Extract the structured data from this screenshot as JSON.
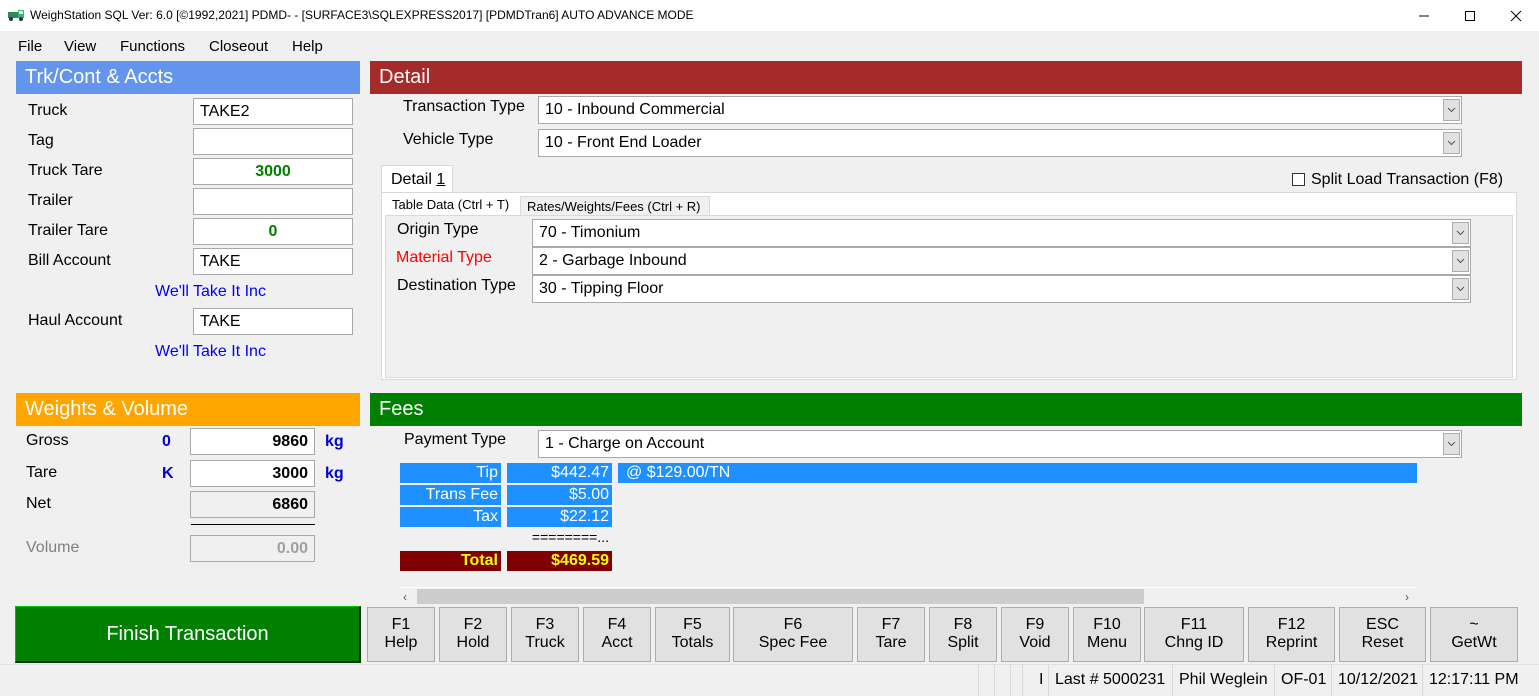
{
  "window": {
    "title": "WeighStation  SQL  Ver: 6.0 [©1992,2021]  PDMD- - [SURFACE3\\SQLEXPRESS2017] [PDMDTran6] AUTO ADVANCE MODE",
    "app_icon": "truck-icon",
    "controls": {
      "minimize": "—",
      "maximize": "☐",
      "close": "✕"
    }
  },
  "menu": [
    "File",
    "View",
    "Functions",
    "Closeout",
    "Help"
  ],
  "trk_panel": {
    "header": "Trk/Cont & Accts",
    "header_color": "#6495ed",
    "truck_label": "Truck",
    "truck_value": "TAKE2",
    "tag_label": "Tag",
    "tag_value": "",
    "truck_tare_label": "Truck Tare",
    "truck_tare_value": "3000",
    "trailer_label": "Trailer",
    "trailer_value": "",
    "trailer_tare_label": "Trailer Tare",
    "trailer_tare_value": "0",
    "bill_account_label": "Bill Account",
    "bill_account_value": "TAKE",
    "bill_account_name": "We'll Take It Inc",
    "haul_account_label": "Haul Account",
    "haul_account_value": "TAKE",
    "haul_account_name": "We'll Take It Inc"
  },
  "weights_panel": {
    "header": "Weights & Volume",
    "header_color": "#ffa500",
    "gross_label": "Gross",
    "gross_flag": "0",
    "gross_value": "9860",
    "gross_unit": "kg",
    "tare_label": "Tare",
    "tare_flag": "K",
    "tare_value": "3000",
    "tare_unit": "kg",
    "net_label": "Net",
    "net_value": "6860",
    "volume_label": "Volume",
    "volume_value": "0.00"
  },
  "detail_panel": {
    "header": "Detail",
    "header_color": "#a52a2a",
    "transaction_type_label": "Transaction Type",
    "transaction_type_value": "10 - Inbound Commercial",
    "vehicle_type_label": "Vehicle Type",
    "vehicle_type_value": "10 - Front End Loader",
    "detail_tab": "Detail 1",
    "split_load_label": "Split Load Transaction (F8)",
    "split_load_checked": false,
    "subtabs": [
      "Table Data (Ctrl + T)",
      "Rates/Weights/Fees (Ctrl + R)"
    ],
    "active_subtab": 0,
    "origin_type_label": "Origin Type",
    "origin_type_value": "70 - Timonium",
    "material_type_label": "Material Type",
    "material_type_value": "2 - Garbage Inbound",
    "destination_type_label": "Destination Type",
    "destination_type_value": "30 - Tipping Floor"
  },
  "fees_panel": {
    "header": "Fees",
    "header_color": "#008000",
    "payment_type_label": "Payment Type",
    "payment_type_value": "1 - Charge on Account",
    "rows": [
      {
        "label": "Tip",
        "amount": "$442.47",
        "note": "@ $129.00/TN"
      },
      {
        "label": "Trans Fee",
        "amount": "$5.00"
      },
      {
        "label": "Tax",
        "amount": "$22.12"
      }
    ],
    "separator": "========...",
    "total_label": "Total",
    "total_amount": "$469.59"
  },
  "actions": {
    "finish": "Finish Transaction",
    "fkeys": [
      {
        "key": "F1",
        "label": "Help"
      },
      {
        "key": "F2",
        "label": "Hold"
      },
      {
        "key": "F3",
        "label": "Truck"
      },
      {
        "key": "F4",
        "label": "Acct"
      },
      {
        "key": "F5",
        "label": "Totals"
      },
      {
        "key": "F6",
        "label": "Spec Fee"
      },
      {
        "key": "F7",
        "label": "Tare"
      },
      {
        "key": "F8",
        "label": "Split"
      },
      {
        "key": "F9",
        "label": "Void"
      },
      {
        "key": "F10",
        "label": "Menu"
      },
      {
        "key": "F11",
        "label": "Chng ID"
      },
      {
        "key": "F12",
        "label": "Reprint"
      },
      {
        "key": "ESC",
        "label": "Reset"
      },
      {
        "key": "~",
        "label": "GetWt"
      }
    ]
  },
  "status_bar": {
    "indicator": "I",
    "last_number": "Last # 5000231",
    "user": "Phil Weglein",
    "station": "OF-01",
    "date": "10/12/2021",
    "time": "12:17:11 PM"
  }
}
